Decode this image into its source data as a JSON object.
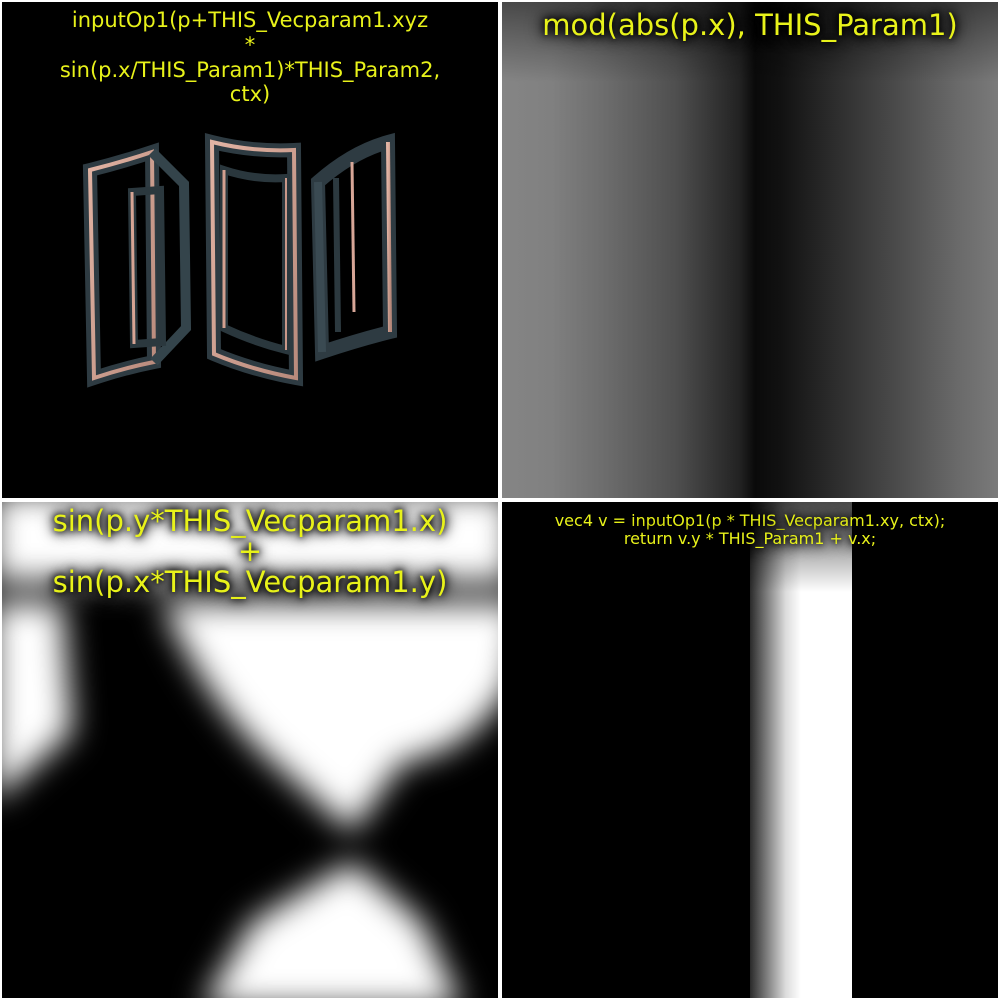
{
  "panels": {
    "top_left": {
      "expression": "inputOp1(p+THIS_Vecparam1.xyz\n*\nsin(p.x/THIS_Param1)*THIS_Param2,\nctx)"
    },
    "top_right": {
      "expression": "mod(abs(p.x), THIS_Param1)"
    },
    "bottom_left": {
      "expression": "sin(p.y*THIS_Vecparam1.x)\n+\nsin(p.x*THIS_Vecparam1.y)"
    },
    "bottom_right": {
      "expression": "vec4 v = inputOp1(p * THIS_Vecparam1.xy, ctx);\nreturn v.y * THIS_Param1  + v.x;"
    }
  },
  "colors": {
    "label_text": "#e8f21a",
    "frame_rim": "#d8a898",
    "frame_body": "#2c3a40"
  }
}
